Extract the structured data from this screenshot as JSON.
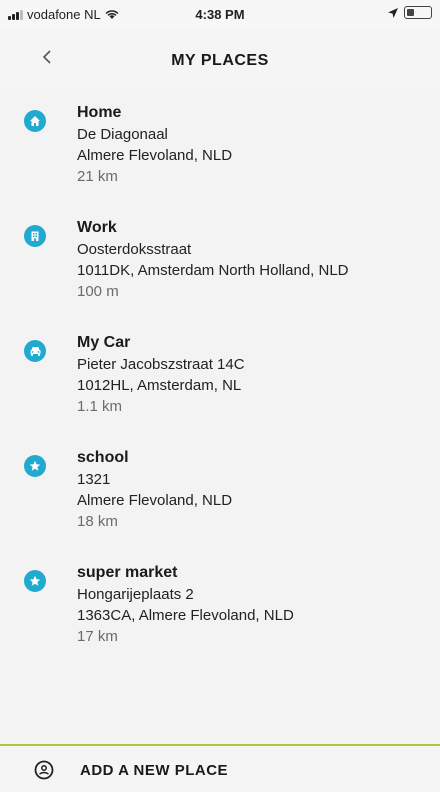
{
  "status_bar": {
    "carrier": "vodafone NL",
    "time": "4:38 PM"
  },
  "header": {
    "title": "MY PLACES"
  },
  "places": [
    {
      "name": "Home",
      "line1": "De Diagonaal",
      "line2": "Almere Flevoland, NLD",
      "distance": "21 km",
      "icon": "home-icon"
    },
    {
      "name": "Work",
      "line1": "Oosterdoksstraat",
      "line2": "1011DK, Amsterdam North Holland, NLD",
      "distance": "100 m",
      "icon": "work-icon"
    },
    {
      "name": "My Car",
      "line1": "Pieter Jacobszstraat 14C",
      "line2": "1012HL, Amsterdam, NL",
      "distance": "1.1 km",
      "icon": "car-icon"
    },
    {
      "name": "school",
      "line1": "1321",
      "line2": "Almere Flevoland, NLD",
      "distance": "18 km",
      "icon": "star-icon"
    },
    {
      "name": "super market",
      "line1": "Hongarijeplaats 2",
      "line2": "1363CA, Almere Flevoland, NLD",
      "distance": "17 km",
      "icon": "star-icon"
    }
  ],
  "footer": {
    "label": "ADD A NEW PLACE"
  },
  "colors": {
    "accent": "#22a9cf",
    "divider": "#a9c93b"
  }
}
